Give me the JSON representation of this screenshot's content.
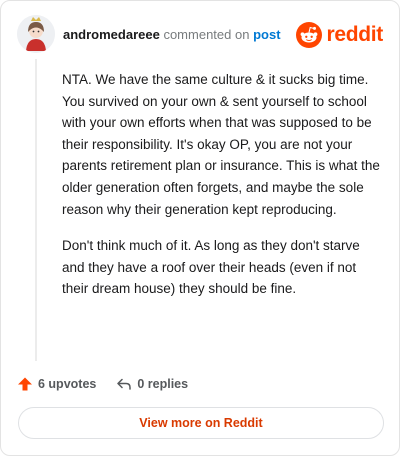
{
  "comment": {
    "author": "andromedareee",
    "action_text": "commented on",
    "target_label": "post",
    "paragraphs": [
      "NTA. We have the same culture & it sucks big time. You survived on your own & sent yourself to school with your own efforts when that was supposed to be their responsibility. It's okay OP, you are not your parents retirement plan or insurance. This is what the older generation often forgets, and maybe the sole reason why their generation kept reproducing.",
      "Don't think much of it. As long as they don't starve and they have a roof over their heads (even if not their dream house) they should be fine."
    ],
    "upvotes_label": "6 upvotes",
    "replies_label": "0 replies"
  },
  "brand": {
    "wordmark": "reddit",
    "accent": "#ff4500"
  },
  "footer": {
    "view_button_label": "View more on Reddit",
    "button_text_color": "#d93a00"
  },
  "icons": {
    "avatar": "user-avatar",
    "logo": "reddit-alien-icon",
    "upvote": "upvote-arrow-icon",
    "reply": "reply-arrow-icon"
  }
}
